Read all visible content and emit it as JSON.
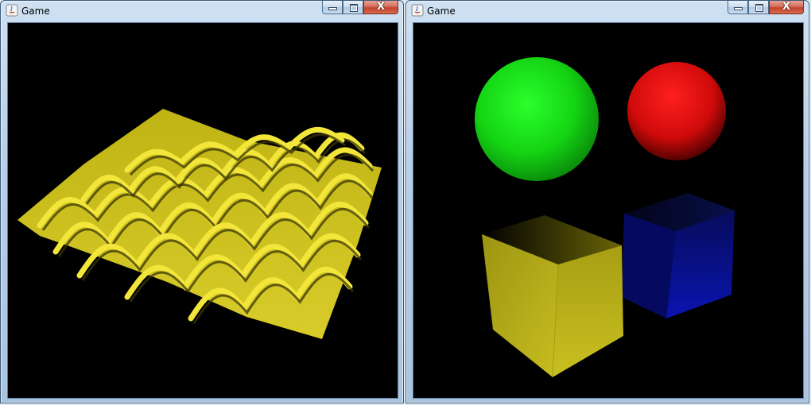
{
  "windows": [
    {
      "title": "Game",
      "scene": "wavy-yellow-surface",
      "colors": {
        "surface": "#d4c81a",
        "background": "#000000"
      }
    },
    {
      "title": "Game",
      "scene": "spheres-and-cubes",
      "colors": {
        "green_sphere": "#16e016",
        "red_sphere": "#ee1010",
        "yellow_cube": "#c8c020",
        "blue_cube": "#0a14b0",
        "background": "#000000"
      }
    }
  ],
  "caption_buttons": {
    "icons": [
      "minimize-icon",
      "maximize-icon",
      "close-icon"
    ],
    "close_glyph": "X"
  }
}
